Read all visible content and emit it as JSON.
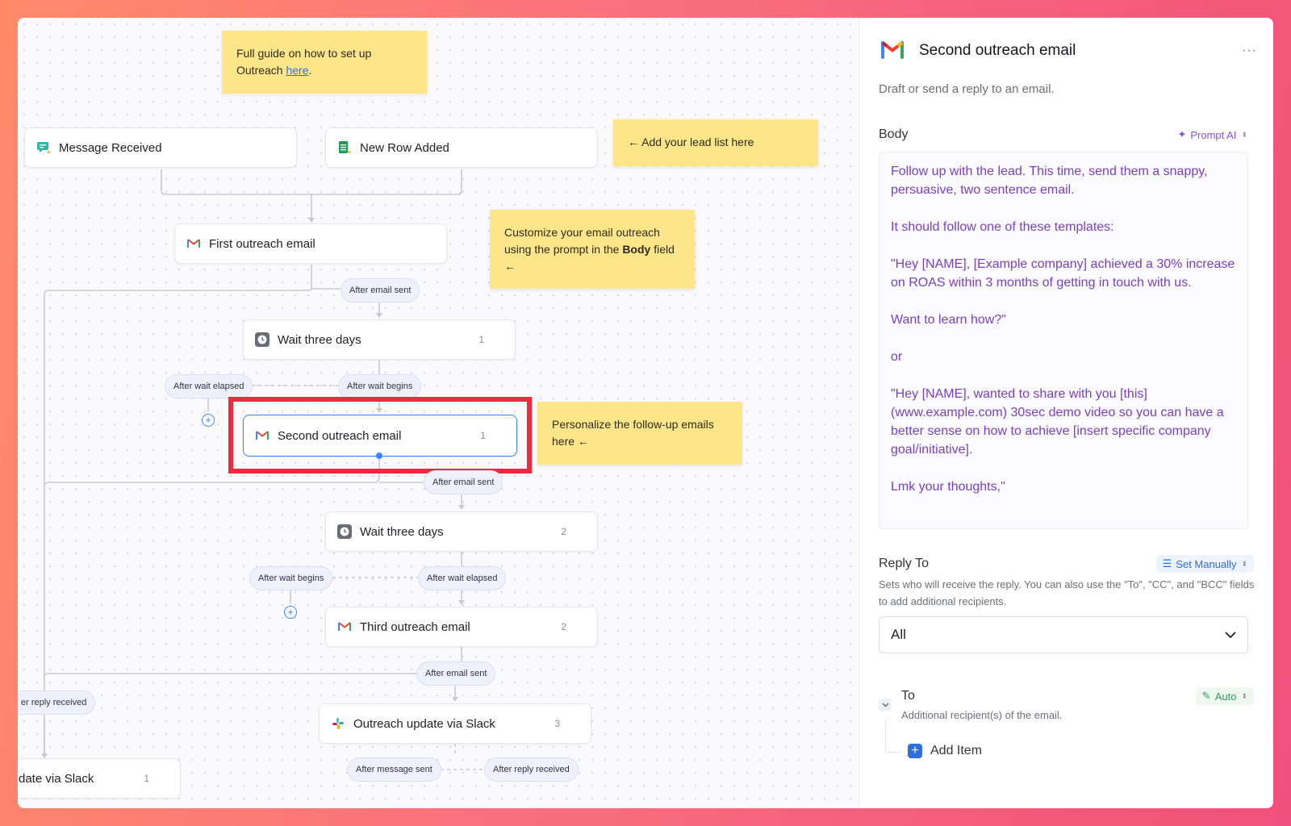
{
  "notes": {
    "guide_prefix": "Full guide on how to set up Outreach ",
    "guide_link": "here",
    "guide_suffix": ".",
    "lead_list": "← Add your lead list here",
    "customize_a": "Customize your email outreach using the prompt in the ",
    "customize_bold": "Body",
    "customize_b": " field ←",
    "personalize": "Personalize the follow-up emails here ←"
  },
  "nodes": {
    "message_received": "Message Received",
    "new_row_added": "New Row Added",
    "first_outreach": "First outreach email",
    "wait1": {
      "label": "Wait three days",
      "count": "1"
    },
    "second_outreach": {
      "label": "Second outreach email",
      "count": "1"
    },
    "wait2": {
      "label": "Wait three days",
      "count": "2"
    },
    "third_outreach": {
      "label": "Third outreach email",
      "count": "2"
    },
    "slack_update": {
      "label": "Outreach update via Slack",
      "count": "3"
    },
    "slack_left": {
      "label": "date via Slack",
      "count": "1"
    }
  },
  "pills": {
    "after_email_sent_1": "After email sent",
    "after_wait_elapsed_1": "After wait elapsed",
    "after_wait_begins_1": "After wait begins",
    "after_email_sent_2": "After email sent",
    "after_wait_begins_2": "After wait begins",
    "after_wait_elapsed_2": "After wait elapsed",
    "after_email_sent_3": "After email sent",
    "reply_received_left": "er reply received",
    "after_message_sent": "After message sent",
    "after_reply_received": "After reply received"
  },
  "panel": {
    "title": "Second outreach email",
    "more": "···",
    "description": "Draft or send a reply to an email.",
    "body_label": "Body",
    "body_mode": "Prompt AI",
    "body_text": [
      "Follow up with the lead. This time, send them a snappy, persuasive, two sentence email.",
      "It should follow one of these templates:",
      "\"Hey [NAME], [Example company] achieved a 30% increase on ROAS within 3 months of getting in touch with us.",
      "Want to learn how?\"",
      "or",
      "\"Hey [NAME], wanted to share with you [this](www.example.com) 30sec demo video so you can have a better sense on how to achieve [insert specific company goal/initiative].",
      "Lmk your thoughts,\""
    ],
    "reply_to_label": "Reply To",
    "reply_to_mode": "Set Manually",
    "reply_to_help": "Sets who will receive the reply. You can also use the \"To\", \"CC\", and \"BCC\" fields to add additional recipients.",
    "reply_to_value": "All",
    "to_label": "To",
    "to_mode": "Auto",
    "to_help": "Additional recipient(s) of the email.",
    "add_item": "Add Item"
  },
  "colors": {
    "note_yellow": "#fde68a",
    "highlight_red": "#ee2b3e",
    "prompt_purple": "#7a3fc4",
    "accent_blue": "#3a86ff"
  }
}
